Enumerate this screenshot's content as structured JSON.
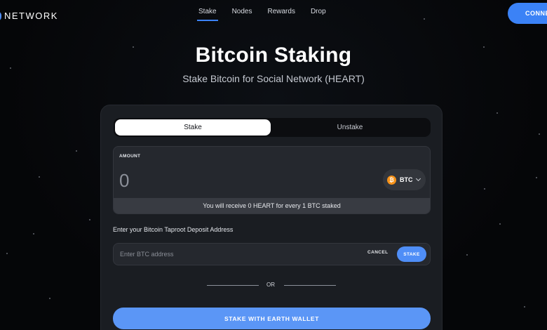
{
  "header": {
    "logo_text": "NETWORK",
    "nav": [
      "Stake",
      "Nodes",
      "Rewards",
      "Drop"
    ],
    "connect_label": "CONNECT"
  },
  "hero": {
    "title": "Bitcoin Staking",
    "subtitle": "Stake Bitcoin for Social Network (HEART)"
  },
  "card": {
    "tabs": {
      "stake": "Stake",
      "unstake": "Unstake"
    },
    "amount": {
      "label": "AMOUNT",
      "value": "0",
      "token_icon": "btc-icon",
      "token_symbol": "BTC",
      "receive_text": "You will receive 0 HEART for every 1 BTC staked"
    },
    "address": {
      "label": "Enter your Bitcoin Taproot Deposit Address",
      "placeholder": "Enter BTC address",
      "cancel_label": "CANCEL",
      "stake_label": "STAKE"
    },
    "or_text": "OR",
    "earth_wallet_label": "STAKE WITH EARTH WALLET"
  },
  "colors": {
    "accent": "#3b82f6",
    "background": "#050608",
    "card": "#1a1d22",
    "btc": "#f7931a"
  }
}
